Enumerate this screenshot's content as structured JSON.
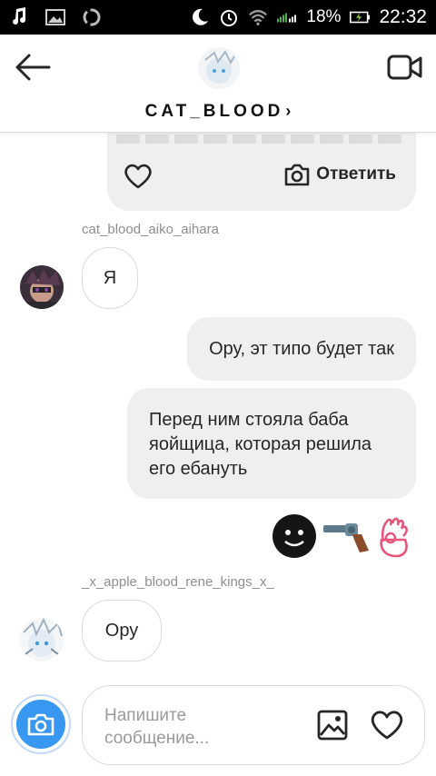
{
  "status_bar": {
    "battery_percent": "18%",
    "time": "22:32",
    "icons": [
      "music-note-icon",
      "image-icon",
      "sync-icon",
      "moon-icon",
      "alarm-icon",
      "wifi-icon",
      "signal-icon",
      "battery-charging-icon"
    ]
  },
  "header": {
    "username": "CAT_BLOOD",
    "chevron": "›",
    "icons": [
      "back-arrow-icon",
      "video-call-icon"
    ]
  },
  "shared_post": {
    "reply_label": "Ответить"
  },
  "messages": [
    {
      "sender": "cat_blood_aiko_aihara",
      "direction": "in",
      "text": "Я"
    },
    {
      "direction": "out",
      "text": "Ору, эт типо будет так"
    },
    {
      "direction": "out",
      "text": "Перед ним стояла баба яойщица, которая решила его ебануть"
    },
    {
      "direction": "out",
      "emojis": [
        "dark-face-emoji",
        "pistol-emoji",
        "ok-hand-emoji"
      ]
    },
    {
      "sender": "_x_apple_blood_rene_kings_x_",
      "direction": "in",
      "text": "Ору"
    }
  ],
  "composer": {
    "placeholder": "Напишите сообщение...",
    "icons": [
      "camera-icon",
      "gallery-icon",
      "heart-icon"
    ]
  },
  "colors": {
    "accent": "#3897f0",
    "bubble_out": "#efefef",
    "border": "#dbdbdb",
    "meta_text": "#8e8e8e"
  }
}
